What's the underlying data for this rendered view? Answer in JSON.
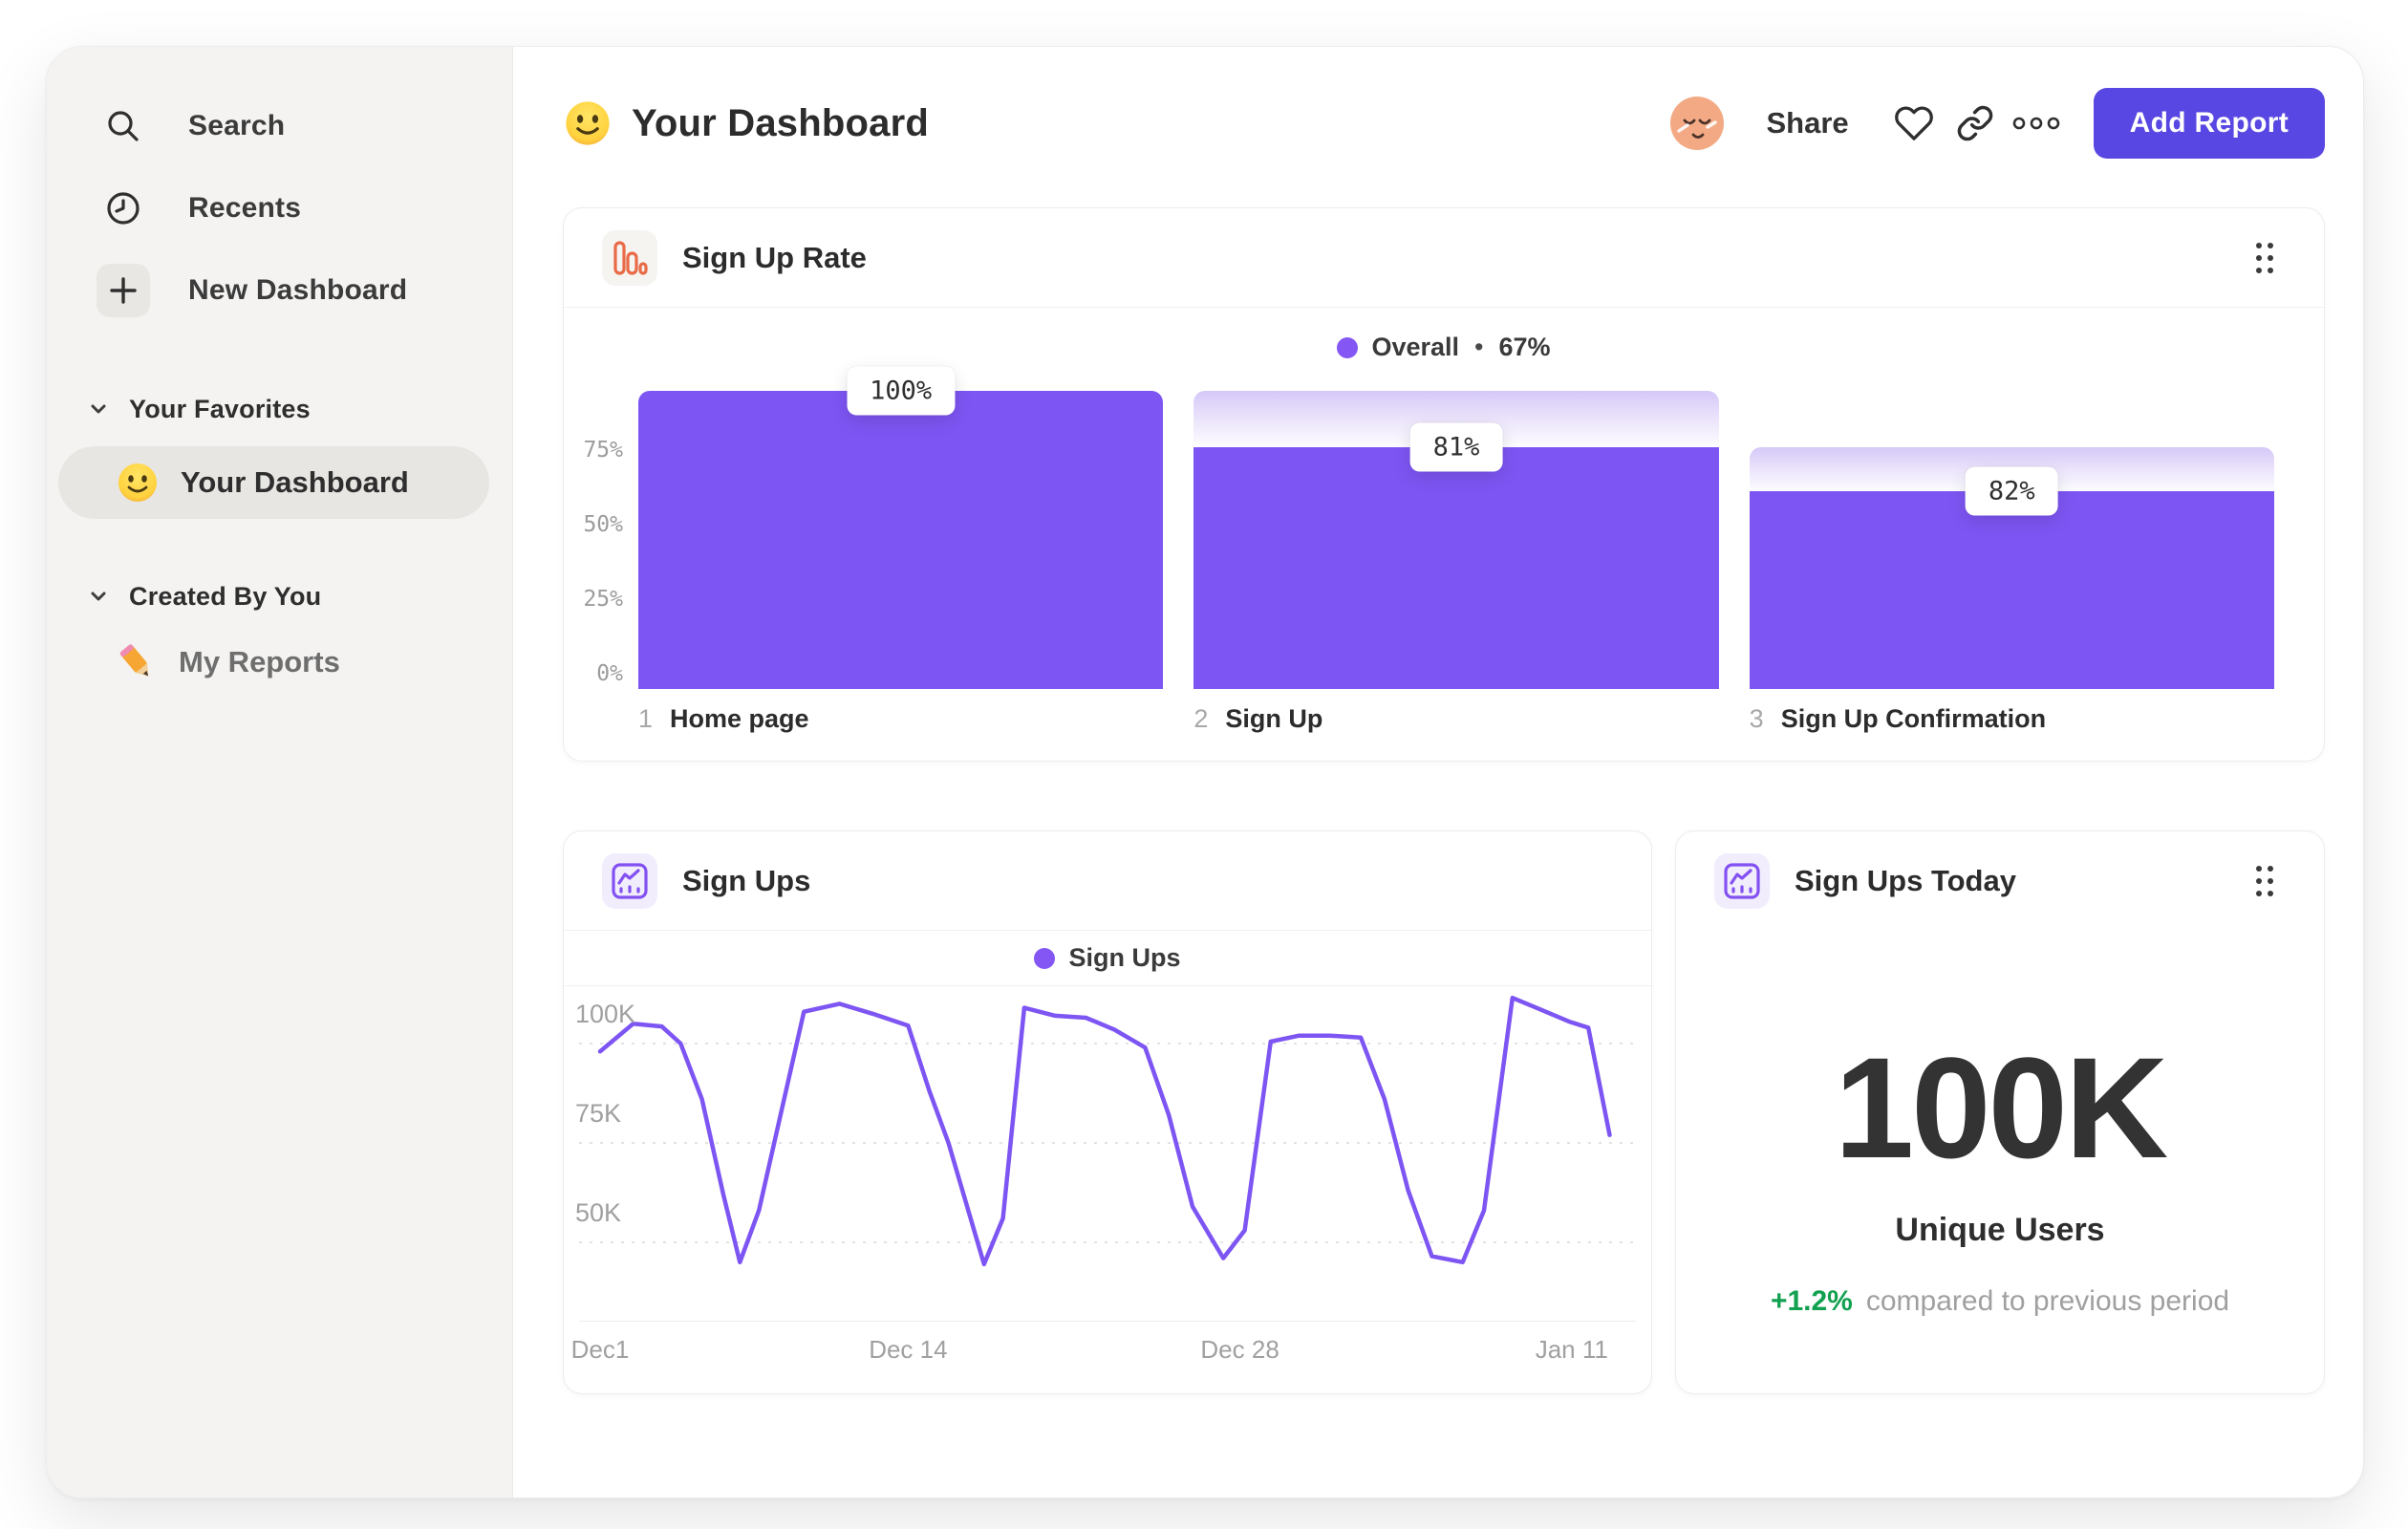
{
  "sidebar": {
    "nav_items": [
      {
        "id": "search",
        "label": "Search"
      },
      {
        "id": "recents",
        "label": "Recents"
      },
      {
        "id": "new-dashboard",
        "label": "New Dashboard"
      }
    ],
    "sections": [
      {
        "label": "Your Favorites",
        "items": [
          {
            "label": "Your Dashboard",
            "emoji": "slightly-smiling-face",
            "selected": true
          }
        ]
      },
      {
        "label": "Created By You",
        "items": [
          {
            "label": "My Reports",
            "emoji": "pencil",
            "selected": false
          }
        ]
      }
    ]
  },
  "header": {
    "emoji": "slightly-smiling-face",
    "title": "Your Dashboard",
    "share_label": "Share",
    "add_report_label": "Add Report",
    "accent_color": "#5847e2"
  },
  "funnel_card": {
    "title": "Sign Up Rate",
    "legend": {
      "series": "Overall",
      "separator": "•",
      "value": "67%"
    }
  },
  "line_card": {
    "title": "Sign Ups",
    "legend": {
      "series": "Sign Ups"
    }
  },
  "stat_card": {
    "title": "Sign Ups Today",
    "value": "100K",
    "label": "Unique Users",
    "delta": "+1.2%",
    "delta_color": "#12a150",
    "delta_note": "compared to previous period"
  },
  "chart_data": [
    {
      "type": "bar",
      "subtype": "funnel",
      "title": "Sign Up Rate",
      "legend": "Overall • 67%",
      "legend_position": "top-center",
      "grid": false,
      "ylim": [
        0,
        100
      ],
      "bar_color": "#7d55f3",
      "yticks": [
        {
          "label": "75%",
          "value": 75
        },
        {
          "label": "50%",
          "value": 50
        },
        {
          "label": "25%",
          "value": 25
        },
        {
          "label": "0%",
          "value": 0
        }
      ],
      "steps": [
        {
          "index": "1",
          "label": "Home page",
          "conversion_label": "100%",
          "overall_pct": 100
        },
        {
          "index": "2",
          "label": "Sign Up",
          "conversion_label": "81%",
          "overall_pct": 81
        },
        {
          "index": "3",
          "label": "Sign Up Confirmation",
          "conversion_label": "82%",
          "overall_pct": 66.4
        }
      ]
    },
    {
      "type": "line",
      "title": "Sign Ups",
      "series_name": "Sign Ups",
      "line_color": "#7d55f3",
      "unit": "K",
      "grid": "dashed-horizontal",
      "legend_position": "top-center",
      "yticks": [
        {
          "label": "100K",
          "value": 100
        },
        {
          "label": "75K",
          "value": 75
        },
        {
          "label": "50K",
          "value": 50
        }
      ],
      "xticks": [
        {
          "label": "Dec1",
          "day": 0
        },
        {
          "label": "Dec 14",
          "day": 13
        },
        {
          "label": "Dec 28",
          "day": 27
        },
        {
          "label": "Jan 11",
          "day": 41
        }
      ],
      "points_day_value": [
        [
          0,
          98
        ],
        [
          1.4,
          105
        ],
        [
          2.6,
          104.3
        ],
        [
          3.4,
          100
        ],
        [
          4.3,
          86
        ],
        [
          5.2,
          62
        ],
        [
          5.9,
          45
        ],
        [
          6.7,
          58
        ],
        [
          8.6,
          108
        ],
        [
          10.1,
          110
        ],
        [
          11.5,
          107.5
        ],
        [
          13,
          104.5
        ],
        [
          13.9,
          88
        ],
        [
          14.7,
          75
        ],
        [
          16.2,
          44.5
        ],
        [
          17,
          56
        ],
        [
          17.9,
          109
        ],
        [
          19.2,
          107
        ],
        [
          20.5,
          106.5
        ],
        [
          21.7,
          103.5
        ],
        [
          23,
          99
        ],
        [
          24,
          82
        ],
        [
          25,
          59
        ],
        [
          26.3,
          46
        ],
        [
          27.2,
          53
        ],
        [
          28.3,
          100.5
        ],
        [
          29.5,
          102
        ],
        [
          30.8,
          102
        ],
        [
          32.1,
          101.5
        ],
        [
          33.1,
          86
        ],
        [
          34.1,
          63
        ],
        [
          35.1,
          46.5
        ],
        [
          36.4,
          45
        ],
        [
          37.3,
          58
        ],
        [
          38.5,
          111.5
        ],
        [
          39.7,
          108.5
        ],
        [
          40.9,
          105.5
        ],
        [
          41.7,
          104
        ],
        [
          42.6,
          77
        ]
      ]
    }
  ]
}
